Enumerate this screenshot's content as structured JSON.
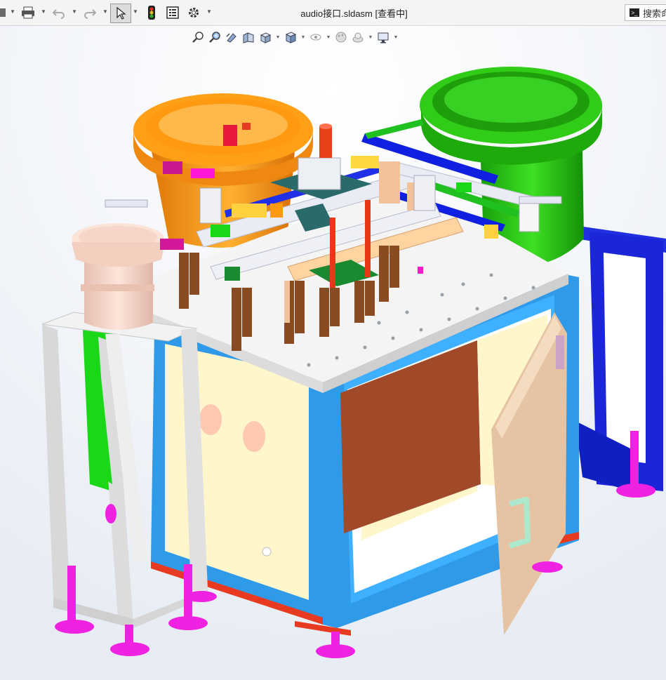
{
  "window": {
    "title": "audio接口.sldasm [查看中]"
  },
  "toolbar": {
    "items": [
      "document-icon",
      "print-icon",
      "undo-icon",
      "redo-icon",
      "select-icon",
      "rebuild-icon",
      "file-properties-icon",
      "options-icon"
    ]
  },
  "search": {
    "label": "搜索命"
  },
  "view_toolbar": {
    "items": [
      "zoom-to-fit-icon",
      "zoom-to-area-icon",
      "previous-view-icon",
      "section-view-icon",
      "view-orientation-icon",
      "display-style-icon",
      "hide-show-items-icon",
      "edit-appearance-icon",
      "apply-scene-icon",
      "view-settings-icon"
    ]
  },
  "colors": {
    "frame_blue": "#2f9be8",
    "panel_cream": "#fff6cc",
    "panel_brown": "#a04a2a",
    "door": "#f0d7b6",
    "bowl_orange": "#ff9a10",
    "bowl_green": "#22c40c",
    "stand_blue": "#1a26d8",
    "feet_magenta": "#ee22e0",
    "plate_white": "#f4f4f4"
  }
}
